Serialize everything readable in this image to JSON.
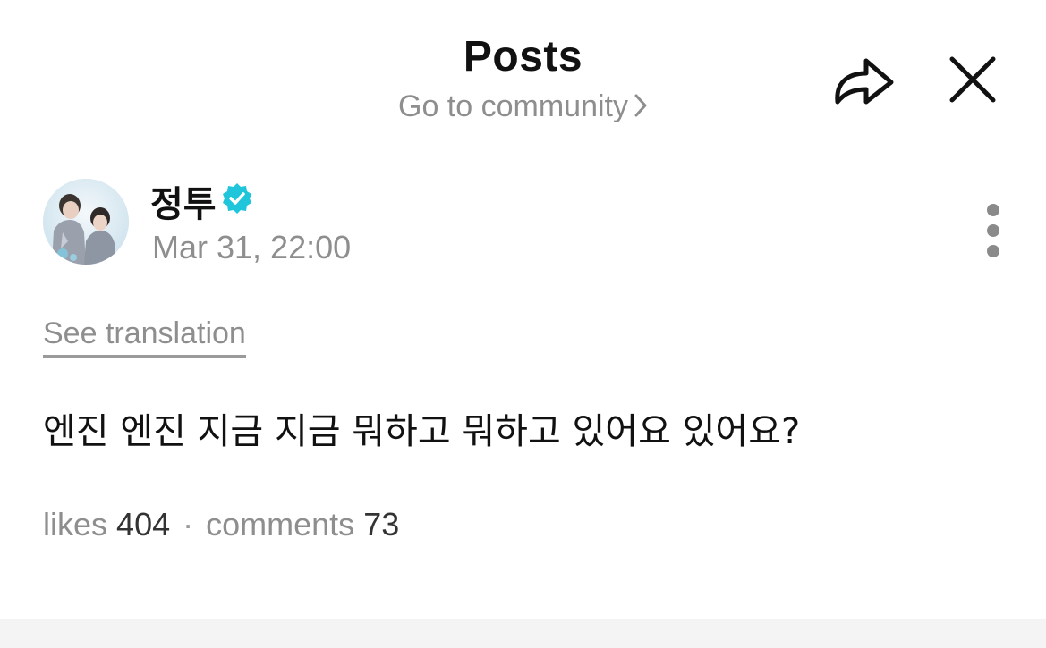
{
  "header": {
    "title": "Posts",
    "community_link": "Go to community",
    "share_icon": "share-arrow-icon",
    "close_icon": "close-icon"
  },
  "post": {
    "author": {
      "name": "정투",
      "verified": true,
      "avatar_icon": "avatar-image"
    },
    "timestamp": "Mar 31, 22:00",
    "see_translation": "See translation",
    "body": "엔진 엔진 지금 지금 뭐하고 뭐하고 있어요 있어요?",
    "stats": {
      "likes_label": "likes",
      "likes_count": "404",
      "separator": "·",
      "comments_label": "comments",
      "comments_count": "73"
    }
  },
  "colors": {
    "text_primary": "#111111",
    "text_secondary": "#8e8e8e",
    "verified_badge": "#1ec5db",
    "divider_band": "#f4f4f4"
  }
}
